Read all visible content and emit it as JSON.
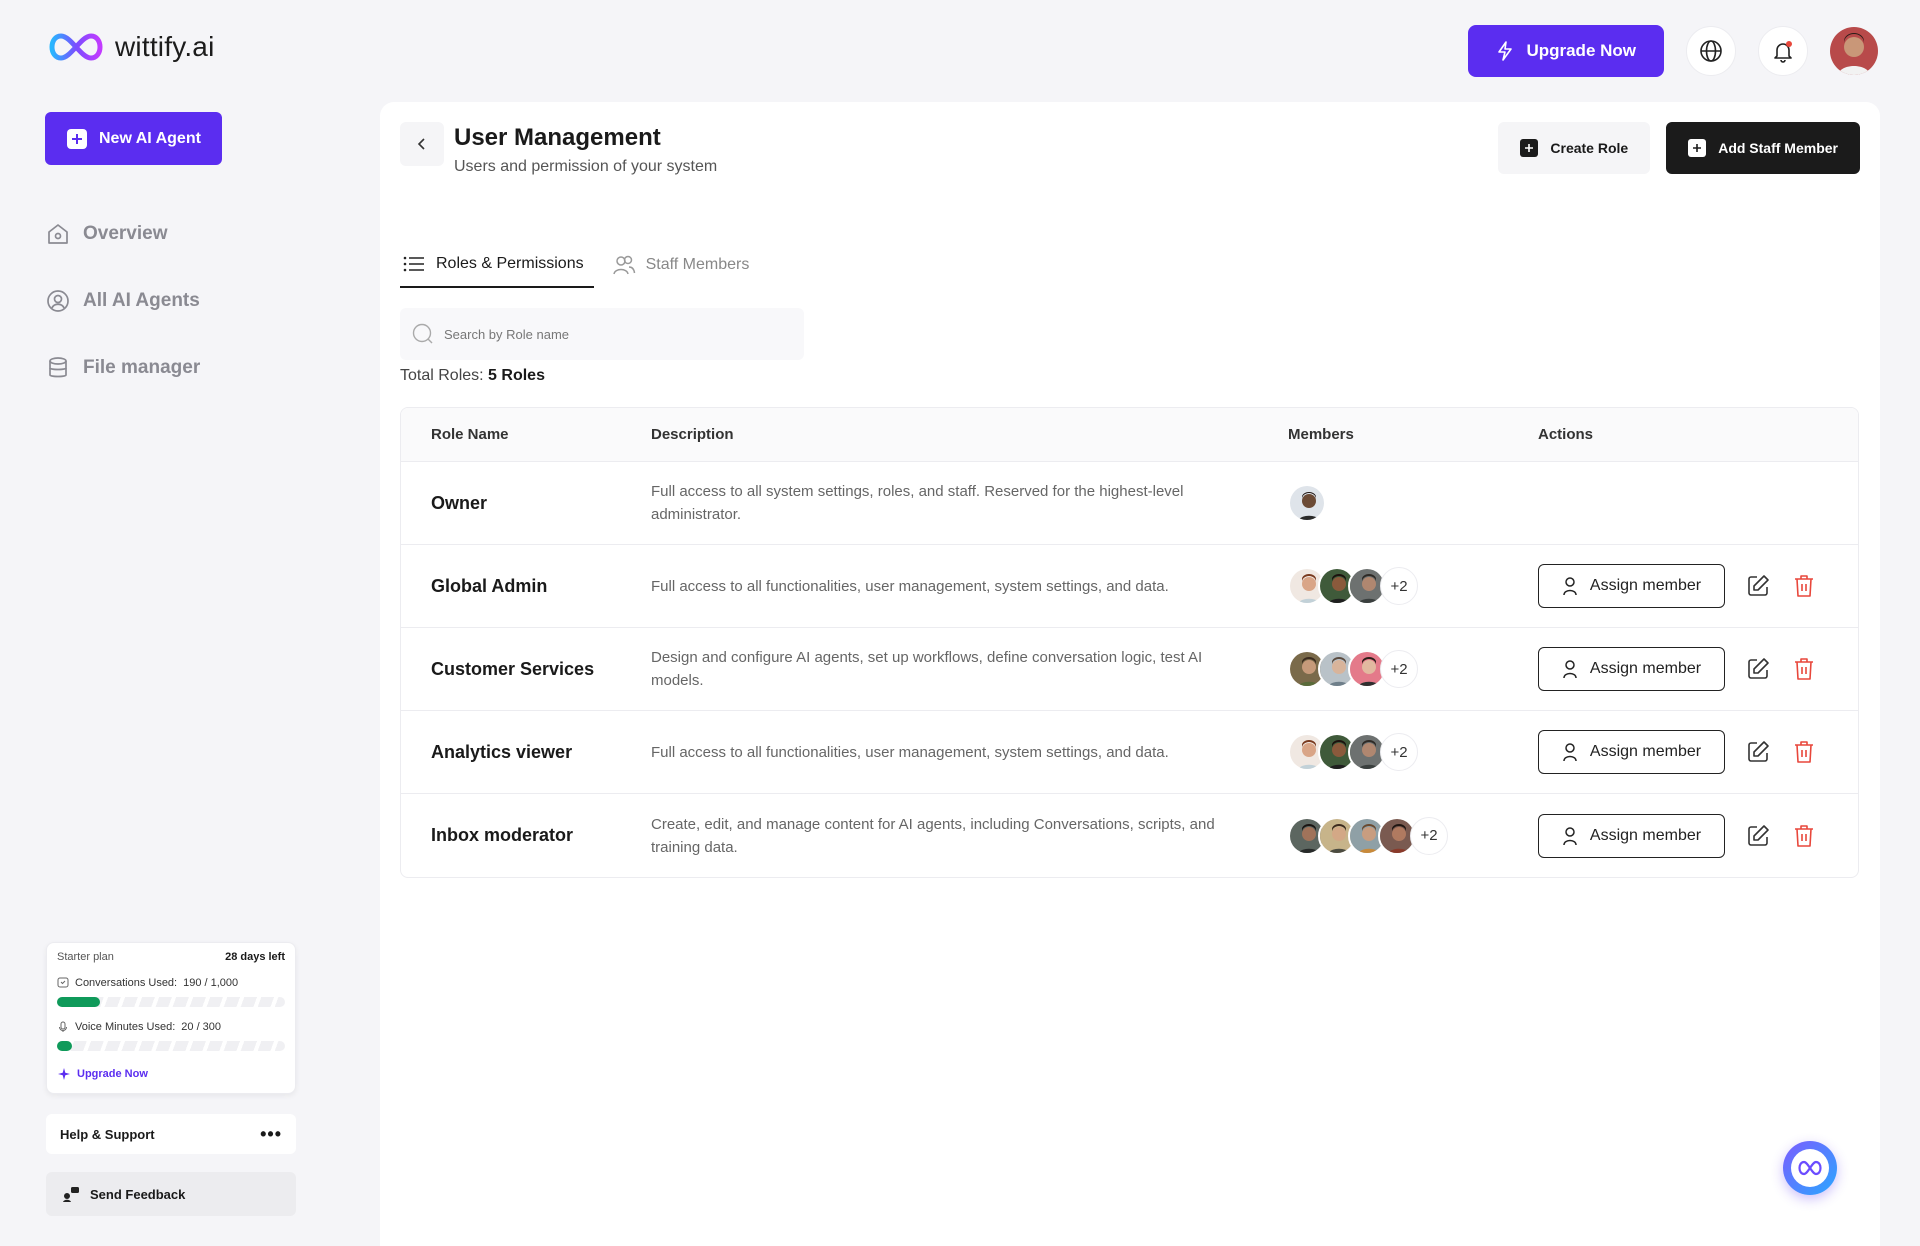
{
  "brand": {
    "name": "wittify.ai",
    "accent": "#5b2df0"
  },
  "topbar": {
    "upgrade_label": "Upgrade Now"
  },
  "sidebar": {
    "new_agent_label": "New AI Agent",
    "items": [
      {
        "label": "Overview",
        "icon": "home-icon"
      },
      {
        "label": "All AI Agents",
        "icon": "agent-icon"
      },
      {
        "label": "File manager",
        "icon": "database-icon"
      }
    ],
    "plan": {
      "name": "Starter plan",
      "days_left": "28 days left",
      "conversations_label": "Conversations Used:",
      "conversations_value": "190 / 1,000",
      "conversations_fraction": 0.19,
      "voice_label": "Voice Minutes Used:",
      "voice_value": "20 / 300",
      "voice_fraction": 0.067,
      "upgrade_label": "Upgrade Now"
    },
    "help_label": "Help & Support",
    "feedback_label": "Send Feedback"
  },
  "main": {
    "title": "User Management",
    "subtitle": "Users and permission of your system",
    "create_role_label": "Create Role",
    "add_staff_label": "Add Staff Member",
    "tabs": [
      {
        "label": "Roles & Permissions",
        "active": true
      },
      {
        "label": "Staff Members",
        "active": false
      }
    ],
    "search_placeholder": "Search by Role name",
    "total_label": "Total Roles:",
    "total_value": "5 Roles",
    "columns": [
      "Role Name",
      "Description",
      "Members",
      "Actions"
    ],
    "assign_label": "Assign member",
    "rows": [
      {
        "name": "Owner",
        "description": "Full access to all system settings, roles, and staff. Reserved for the highest-level administrator.",
        "more": "",
        "actions": false
      },
      {
        "name": "Global Admin",
        "description": "Full access to all functionalities, user management, system settings, and data.",
        "more": "+2",
        "actions": true
      },
      {
        "name": "Customer Services",
        "description": "Design and configure AI agents, set up workflows, define conversation logic, test AI models.",
        "more": "+2",
        "actions": true
      },
      {
        "name": "Analytics viewer",
        "description": "Full access to all functionalities, user management, system settings, and data.",
        "more": "+2",
        "actions": true
      },
      {
        "name": "Inbox moderator",
        "description": "Create, edit, and manage content for AI agents, including Conversations, scripts, and training data.",
        "more": "+2",
        "actions": true
      }
    ]
  }
}
